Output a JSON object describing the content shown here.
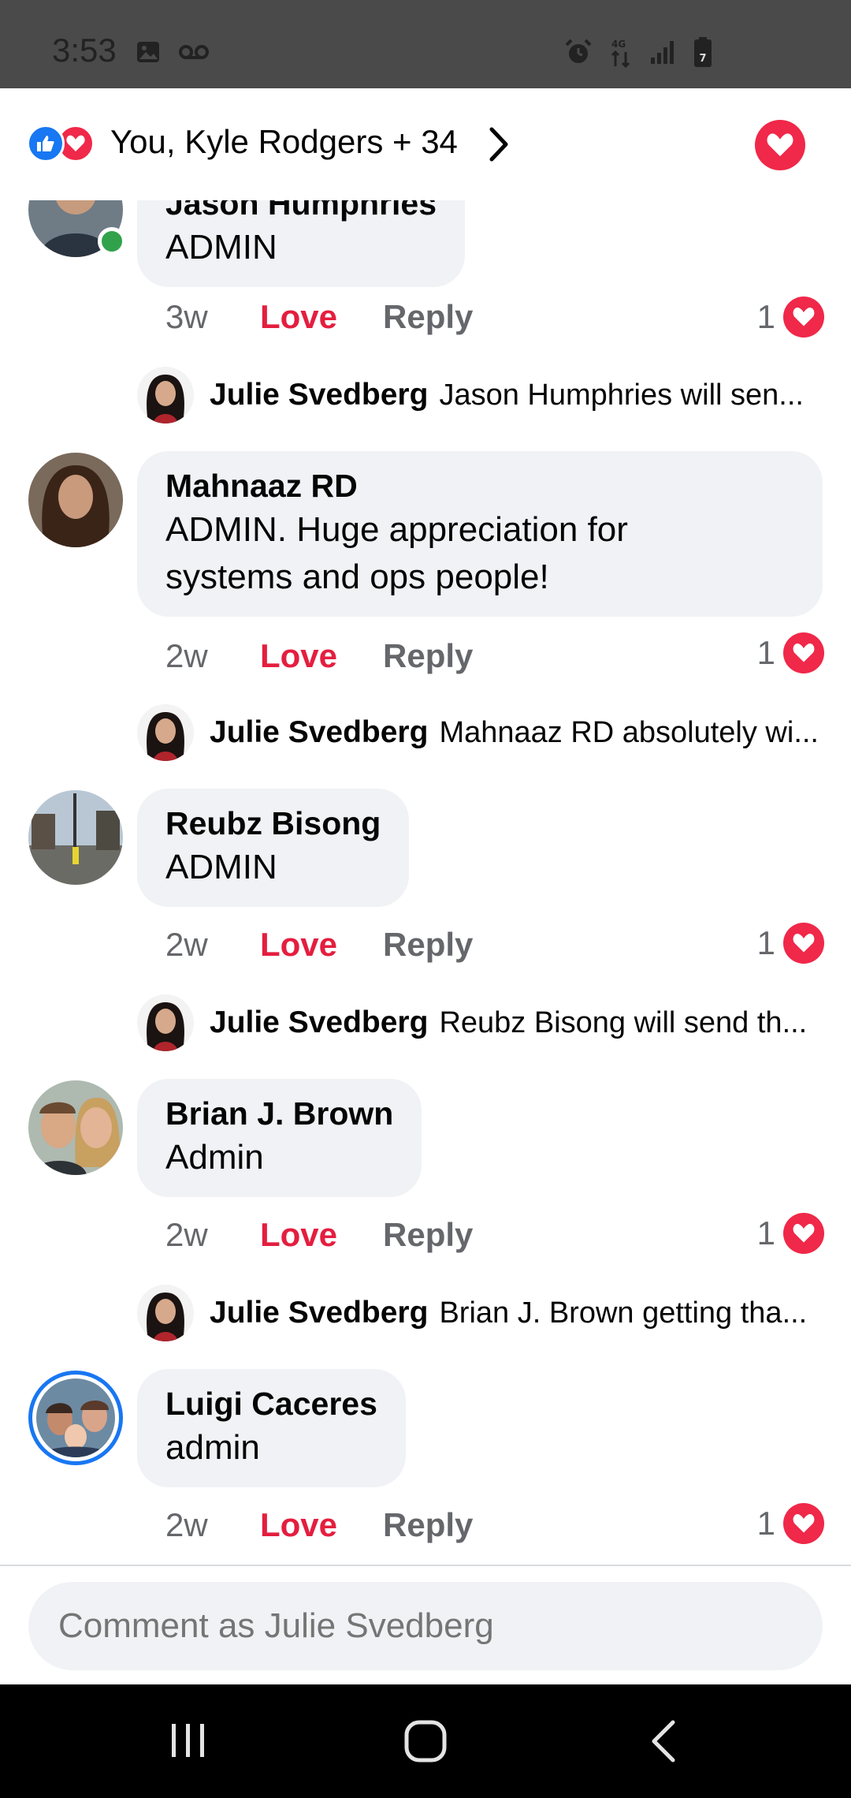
{
  "status_bar": {
    "time": "3:53",
    "left_icons": [
      "image-icon",
      "voicemail-icon"
    ],
    "right_icons": [
      "alarm-icon",
      "data-transfer-icon",
      "signal-icon",
      "battery-icon"
    ],
    "battery_level": "7"
  },
  "header": {
    "reaction_icons": [
      "like-reaction-icon",
      "love-reaction-icon"
    ],
    "reactors_text": "You, Kyle Rodgers + 34",
    "colors": {
      "like": "#1877f2",
      "love": "#f02849"
    }
  },
  "comments": [
    {
      "author": "Jason Humphries",
      "text": "ADMIN",
      "time": "3w",
      "love_label": "Love",
      "reply_label": "Reply",
      "reaction_count": "1",
      "online": true,
      "reply": {
        "author": "Julie Svedberg",
        "text": "Jason Humphries will sen..."
      }
    },
    {
      "author": "Mahnaaz RD",
      "text": "ADMIN. Huge appreciation for systems and ops people!",
      "time": "2w",
      "love_label": "Love",
      "reply_label": "Reply",
      "reaction_count": "1",
      "reply": {
        "author": "Julie Svedberg",
        "text": "Mahnaaz RD absolutely wi..."
      }
    },
    {
      "author": "Reubz Bisong",
      "text": "ADMIN",
      "time": "2w",
      "love_label": "Love",
      "reply_label": "Reply",
      "reaction_count": "1",
      "reply": {
        "author": "Julie Svedberg",
        "text": "Reubz Bisong will send th..."
      }
    },
    {
      "author": "Brian J. Brown",
      "text": "Admin",
      "time": "2w",
      "love_label": "Love",
      "reply_label": "Reply",
      "reaction_count": "1",
      "reply": {
        "author": "Julie Svedberg",
        "text": "Brian J. Brown getting tha..."
      }
    },
    {
      "author": "Luigi Caceres",
      "text": "admin",
      "time": "2w",
      "love_label": "Love",
      "reply_label": "Reply",
      "reaction_count": "1",
      "story_ring": true
    }
  ],
  "composer": {
    "placeholder": "Comment as Julie Svedberg"
  },
  "nav_bar": {
    "buttons": [
      "recent-apps-icon",
      "home-icon",
      "back-icon"
    ]
  }
}
